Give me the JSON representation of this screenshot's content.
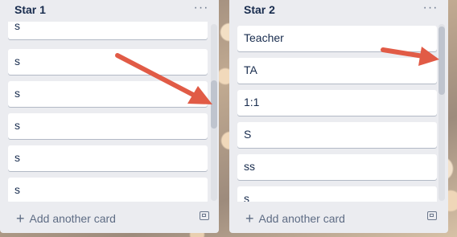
{
  "lists": [
    {
      "title": "Star 1",
      "cards": [
        "s",
        "s",
        "s",
        "s",
        "s",
        "s"
      ],
      "add_card_label": "Add another card"
    },
    {
      "title": "Star 2",
      "cards": [
        "Teacher",
        "TA",
        "1:1",
        "S",
        "ss",
        "s"
      ],
      "add_card_label": "Add another card"
    }
  ],
  "icons": {
    "list_menu": "ellipsis-icon",
    "add": "plus-icon",
    "template": "card-template-icon",
    "annotation": "red-arrow-icon"
  },
  "colors": {
    "list_background": "#ebecf0",
    "card_background": "#ffffff",
    "text": "#172b4d",
    "annotation_arrow": "#e15b46"
  }
}
